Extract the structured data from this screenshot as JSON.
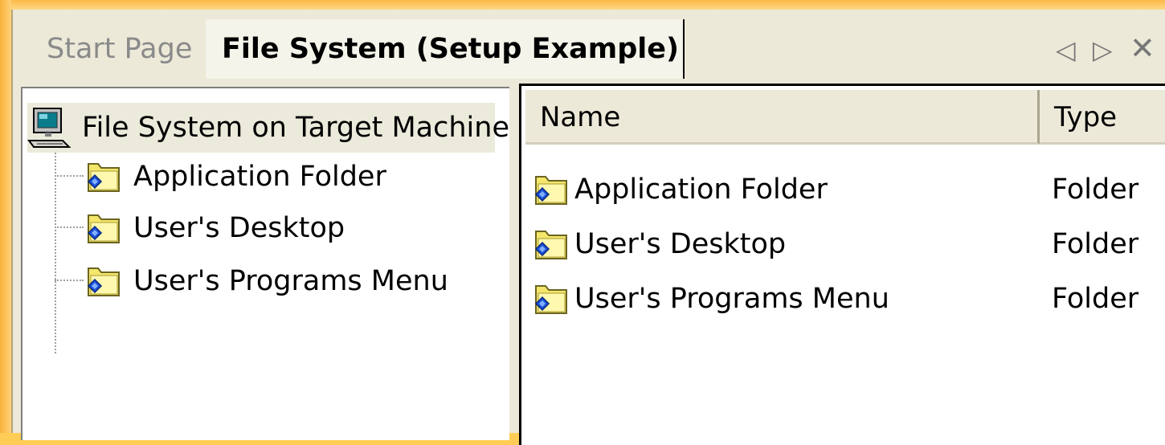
{
  "tabs": {
    "inactive_label": "Start Page",
    "active_label": "File System (Setup Example)"
  },
  "tab_nav": {
    "prev_glyph": "◁",
    "next_glyph": "▷",
    "close_glyph": "✕"
  },
  "tree": {
    "root_label": "File System on Target Machine",
    "items": [
      {
        "label": "Application Folder",
        "icon": "folder-icon"
      },
      {
        "label": "User's Desktop",
        "icon": "folder-icon"
      },
      {
        "label": "User's Programs Menu",
        "icon": "folder-icon"
      }
    ]
  },
  "list": {
    "columns": [
      "Name",
      "Type"
    ],
    "rows": [
      {
        "name": "Application Folder",
        "type": "Folder"
      },
      {
        "name": "User's Desktop",
        "type": "Folder"
      },
      {
        "name": "User's Programs Menu",
        "type": "Folder"
      }
    ]
  },
  "colors": {
    "background_orange": "#ffcc55",
    "chrome": "#ece9d8",
    "folder_yellow": "#f3e66b",
    "shortcut_blue": "#1c4fd8"
  }
}
